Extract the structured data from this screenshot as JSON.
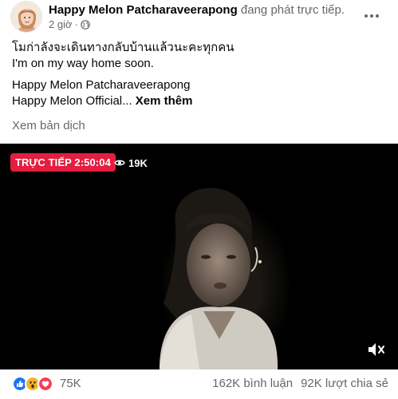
{
  "post": {
    "page_name": "Happy Melon Patcharaveerapong",
    "live_status": "đang phát trực tiếp.",
    "time": "2 giờ",
    "privacy_icon": "globe-icon",
    "more_icon": "more-horizontal-icon"
  },
  "caption": {
    "line1": "โมก่าลังจะเดินทางกลับบ้านแล้วนะคะทุกคน",
    "line2": "I'm on my way home soon.",
    "line3": "Happy Melon Patcharaveerapong",
    "line4": "Happy Melon Official...",
    "see_more": "Xem thêm",
    "translate": "Xem bản dịch"
  },
  "video": {
    "live_label": "TRỰC TIẾP 2:50:04",
    "viewers": "19K",
    "viewers_icon": "eye-icon",
    "mute_icon": "speaker-muted-icon"
  },
  "footer": {
    "reactions": [
      "like-icon",
      "love-icon",
      "wow-icon"
    ],
    "reaction_count": "75K",
    "comments": "162K bình luận",
    "shares": "92K lượt chia sẻ"
  },
  "colors": {
    "live_red": "#e41e3f",
    "like_blue": "#1877f2",
    "love_red": "#f33e58",
    "wow_yellow": "#f7b125",
    "secondary_text": "#65676b"
  }
}
